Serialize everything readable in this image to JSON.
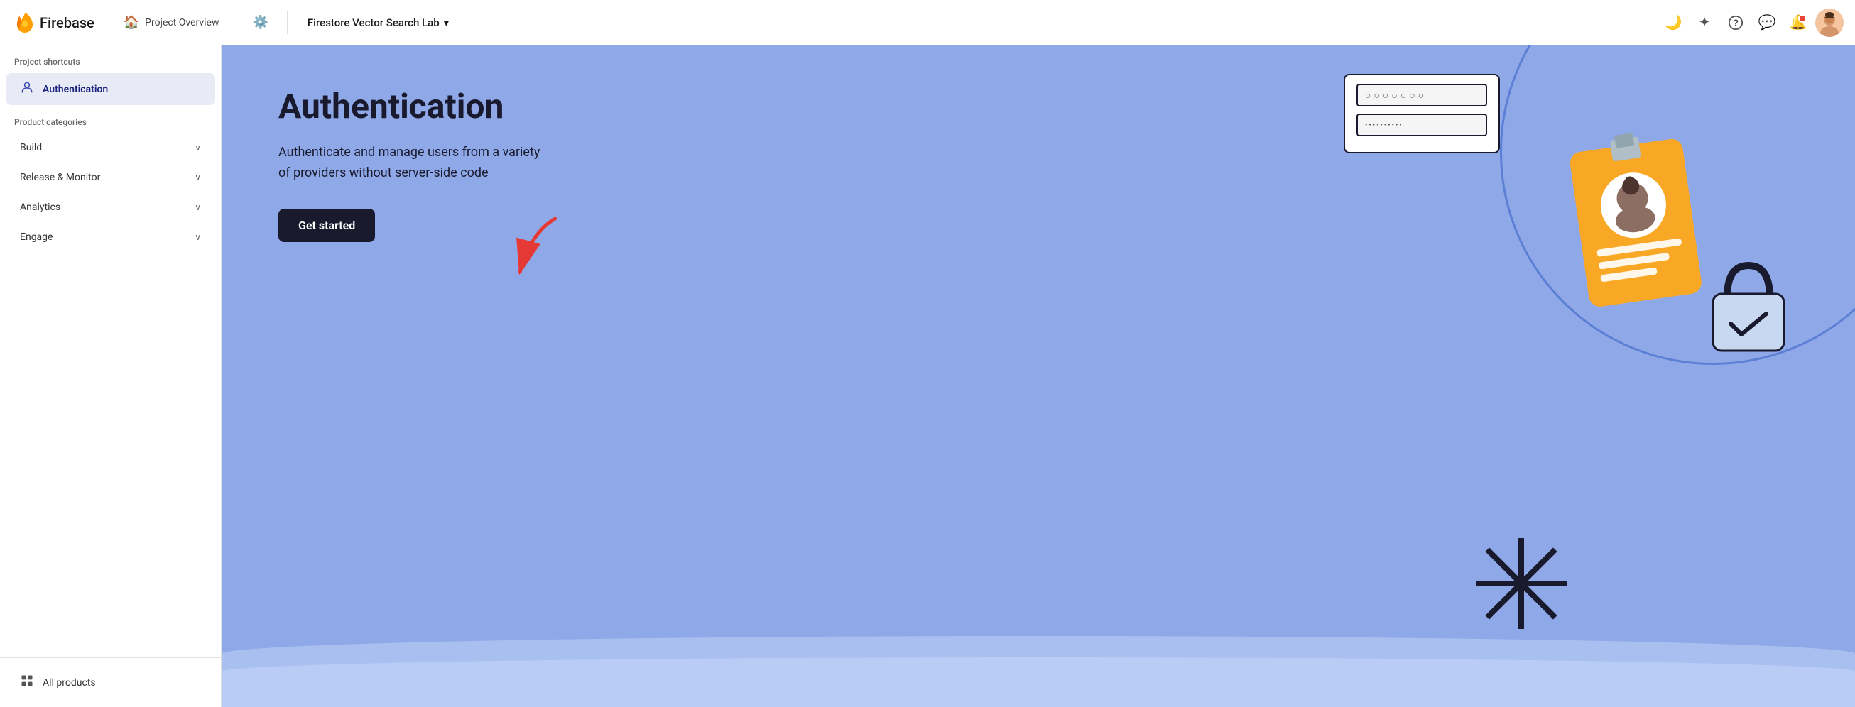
{
  "topNav": {
    "logo_text": "Firebase",
    "project_overview_label": "Project Overview",
    "project_name": "Firestore Vector Search Lab",
    "dropdown_icon": "▾"
  },
  "sidebar": {
    "shortcuts_label": "Project shortcuts",
    "shortcuts": [
      {
        "id": "authentication",
        "label": "Authentication",
        "icon": "👤",
        "active": true
      }
    ],
    "categories_label": "Product categories",
    "categories": [
      {
        "id": "build",
        "label": "Build"
      },
      {
        "id": "release-monitor",
        "label": "Release & Monitor"
      },
      {
        "id": "analytics",
        "label": "Analytics"
      },
      {
        "id": "engage",
        "label": "Engage"
      }
    ],
    "all_products_label": "All products"
  },
  "main": {
    "title": "Authentication",
    "description": "Authenticate and manage users from a variety of providers without server-side code",
    "cta_label": "Get started",
    "login_dots_1": "○○○○○○○",
    "login_dots_2": "••••••••••"
  },
  "icons": {
    "home": "⌂",
    "gear": "⚙",
    "moon": "🌙",
    "sparkle": "✦",
    "help": "?",
    "chat": "💬",
    "bell": "🔔",
    "grid": "⊞",
    "chevron_down": "∨"
  }
}
